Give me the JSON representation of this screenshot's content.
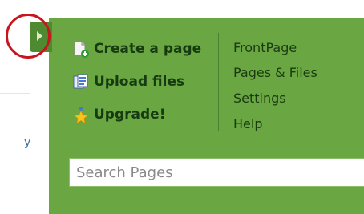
{
  "background": {
    "fragment_text": "y"
  },
  "toggle": {
    "icon": "chevron-right-icon"
  },
  "actions": [
    {
      "label": "Create a page",
      "icon": "new-page-icon"
    },
    {
      "label": "Upload files",
      "icon": "upload-files-icon"
    },
    {
      "label": "Upgrade!",
      "icon": "upgrade-star-icon"
    }
  ],
  "nav": [
    "FrontPage",
    "Pages & Files",
    "Settings",
    "Help"
  ],
  "search": {
    "placeholder": "Search Pages",
    "value": ""
  },
  "colors": {
    "panel": "#6aa743",
    "tab": "#4f8a30",
    "highlight": "#c8141c",
    "text": "#173b10"
  }
}
